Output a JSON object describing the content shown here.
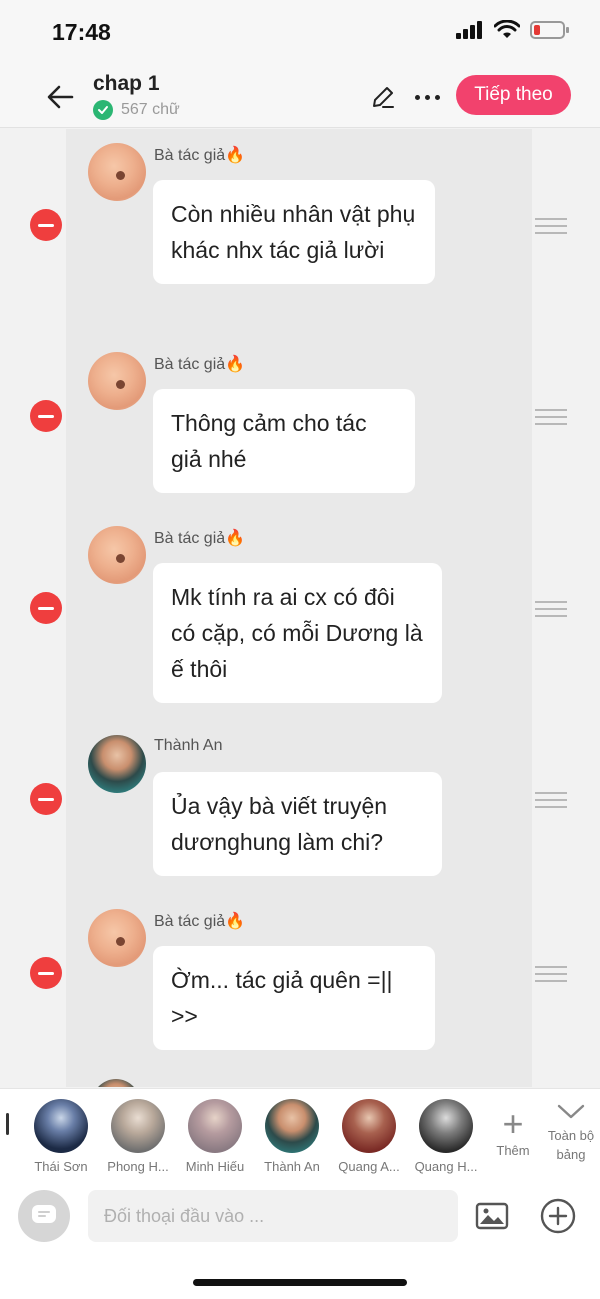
{
  "status_bar": {
    "time": "17:48"
  },
  "header": {
    "title": "chap 1",
    "word_count": "567 chữ",
    "next_button": "Tiếp theo"
  },
  "messages": [
    {
      "sender": "Bà tác giả🔥",
      "avatar": "author-avatar",
      "text": "Còn nhiều nhân vật phụ khác nhx tác giả lười"
    },
    {
      "sender": "Bà tác giả🔥",
      "avatar": "author-avatar",
      "text": "Thông cảm cho tác giả nhé"
    },
    {
      "sender": "Bà tác giả🔥",
      "avatar": "author-avatar",
      "text": "Mk tính ra ai cx có đôi có cặp, có mỗi Dương là ế thôi"
    },
    {
      "sender": "Thành An",
      "avatar": "character-avatar",
      "text": "Ủa vậy bà viết truyện dươnghung làm chi?"
    },
    {
      "sender": "Bà tác giả🔥",
      "avatar": "author-avatar",
      "text": "Ờm... tác giả quên =|| >>"
    }
  ],
  "characters": [
    {
      "name": "Thái Sơn",
      "color": "#1c2a45"
    },
    {
      "name": "Phong H...",
      "color": "#6f6f6f"
    },
    {
      "name": "Minh Hiếu",
      "color": "#8a7a82"
    },
    {
      "name": "Thành An",
      "color": "#2f7c7c"
    },
    {
      "name": "Quang A...",
      "color": "#7a2a25"
    },
    {
      "name": "Quang H...",
      "color": "#2a2a2a"
    }
  ],
  "more_characters_label": "Thêm",
  "all_table_label": "Toàn bộ bảng",
  "input": {
    "placeholder": "Đối thoại đầu vào ..."
  },
  "colors": {
    "accent": "#f2426d",
    "remove": "#ef3e3e",
    "verified": "#2bb673"
  }
}
